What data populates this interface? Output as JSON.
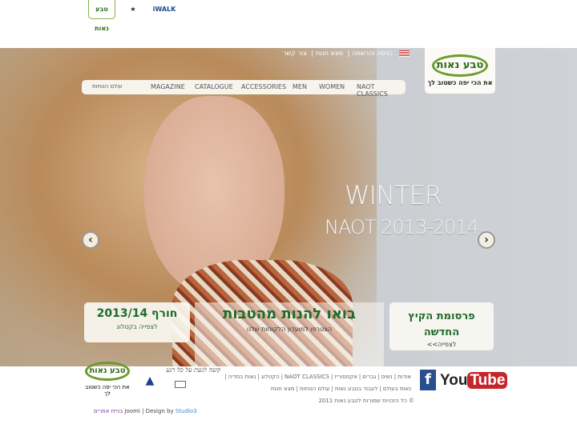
{
  "header": {
    "brand_tabs": [
      "טבע נאות",
      "Arcopedico",
      "iWALK"
    ],
    "top_links": [
      "כניסה והרשמה",
      "מצא חנות",
      "צור קשר"
    ],
    "language_flag": "us-flag-icon",
    "logo": {
      "name": "טבע נאות",
      "tagline": "את הכי יפה כשטוב לך"
    },
    "nav": [
      "NAOT CLASSICS",
      "WOMEN",
      "MEN",
      "ACCESSORIES",
      "CATALOGUE",
      "MAGAZINE",
      "עולם הנוחות"
    ]
  },
  "hero": {
    "title_line1": "WINTER",
    "title_line2": "NAOT 2013-2014",
    "prev": "‹",
    "next": "›",
    "promo_left": {
      "title": "חורף 2013/14",
      "link": "לצפייה בקטלוג"
    },
    "promo_center": {
      "title": "בואו להנות מהטבות",
      "subtitle": "הצטרפו למועדון הלקוחות שלנו"
    },
    "promo_right": {
      "title": "פרסומת הקיץ החדשה",
      "link": "לצפייה>>"
    }
  },
  "footer": {
    "logo": {
      "name": "טבע נאות",
      "tagline": "את הכי יפה כשטוב לך"
    },
    "signature": "קשה לגעת על כל רגע",
    "social": [
      "Facebook",
      "YouTube"
    ],
    "links_row1": [
      "אודות",
      "נשים",
      "גברים",
      "אקססוריז",
      "NAOT CLASSICS",
      "הקטלוג",
      "נאות במדיה"
    ],
    "links_row2": [
      "נאות בעולם",
      "לעבוד בטבע נאות",
      "עולם הנוחות",
      "מצא חנות"
    ],
    "copyright": "© כל הזכויות שמורות לטבע נאות 2011",
    "credit_hebrew": "בניית אתרים",
    "credit_joomi": "Joomi | Design by",
    "credit_studio": "Studio3"
  },
  "colors": {
    "brand_green": "#1d6b2a",
    "accent_lime": "#6a9c2a"
  }
}
